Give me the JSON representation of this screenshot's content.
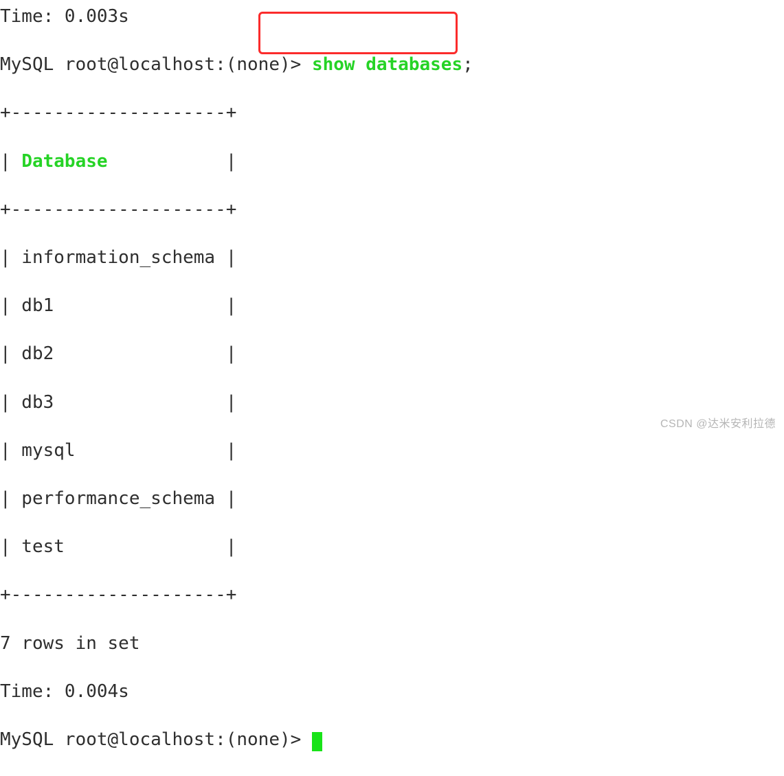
{
  "header_time_partial": "Time: 0.003s",
  "prompt": "MySQL root@localhost:(none)> ",
  "command": "show databases",
  "semicolon": ";",
  "table": {
    "border_top": "+--------------------+",
    "header_line": "| ",
    "header_label": "Database",
    "header_pad": "           |",
    "border_mid": "+--------------------+",
    "rows": [
      "| information_schema |",
      "| db1                |",
      "| db2                |",
      "| db3                |",
      "| mysql              |",
      "| performance_schema |",
      "| test               |"
    ],
    "border_bot": "+--------------------+"
  },
  "result_summary": "7 rows in set",
  "result_time": "Time: 0.004s",
  "prompt2": "MySQL root@localhost:(none)> ",
  "watermark": "CSDN @达米安利拉德"
}
